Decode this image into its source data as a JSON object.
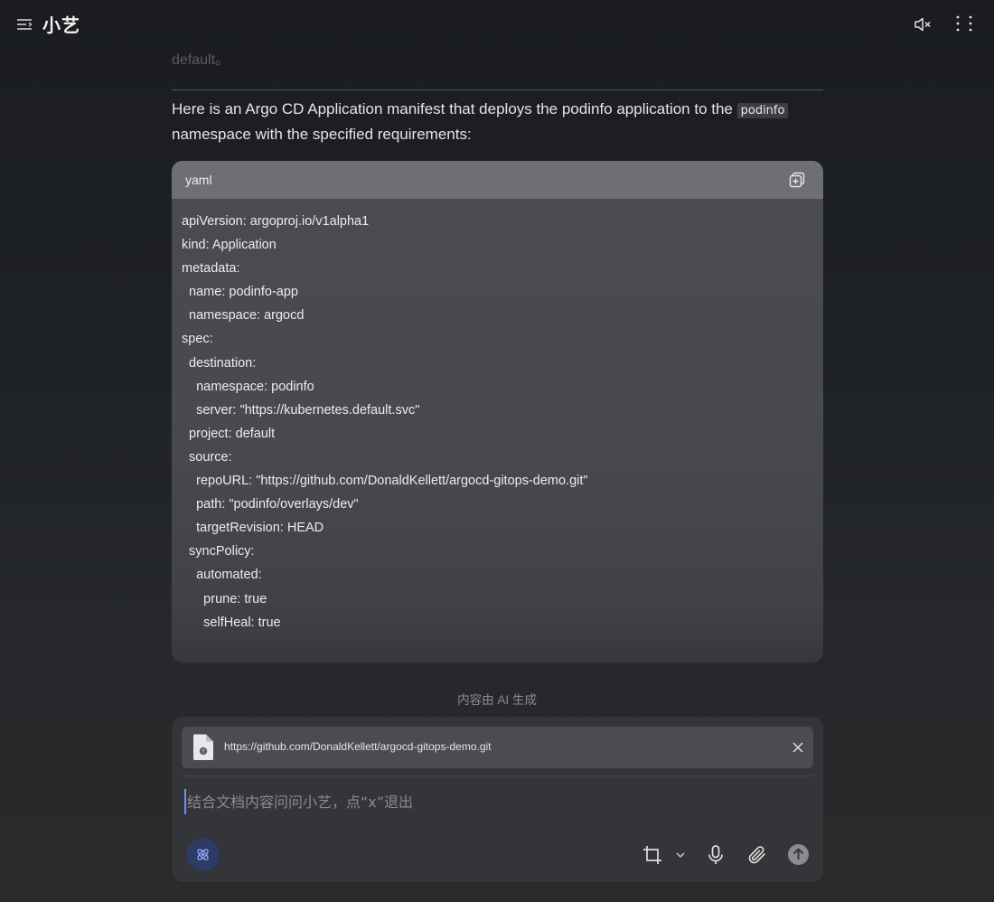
{
  "header": {
    "title": "小艺",
    "icons": {
      "menu": "menu-icon",
      "mute": "volume-mute-icon",
      "fullscreen": "fullscreen-icon"
    }
  },
  "message": {
    "faded_text": "default。",
    "intro_before": "Here is an Argo CD Application manifest that deploys the podinfo application to the ",
    "intro_code": "podinfo",
    "intro_after": " namespace with the specified requirements:"
  },
  "code_block": {
    "language": "yaml",
    "lines": [
      "apiVersion: argoproj.io/v1alpha1",
      "kind: Application",
      "metadata:",
      "  name: podinfo-app",
      "  namespace: argocd",
      "spec:",
      "  destination:",
      "    namespace: podinfo",
      "    server: \"https://kubernetes.default.svc\"",
      "  project: default",
      "  source:",
      "    repoURL: \"https://github.com/DonaldKellett/argocd-gitops-demo.git\"",
      "    path: \"podinfo/overlays/dev\"",
      "    targetRevision: HEAD",
      "  syncPolicy:",
      "    automated:",
      "      prune: true",
      "      selfHeal: true"
    ]
  },
  "ai_note": "内容由 AI 生成",
  "input_panel": {
    "attachment_url": "https://github.com/DonaldKellett/argocd-gitops-demo.git",
    "placeholder": "结合文档内容问问小艺，点“x”退出",
    "value": ""
  },
  "colors": {
    "accent": "#6c8cff",
    "agent_button_bg": "#2d3b66"
  }
}
